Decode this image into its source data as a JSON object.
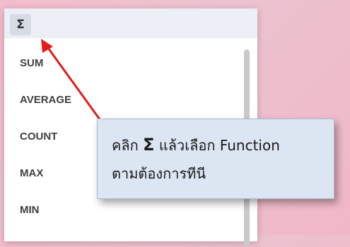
{
  "menu": {
    "sigma_button_label": "Σ",
    "items": [
      {
        "label": "SUM"
      },
      {
        "label": "AVERAGE"
      },
      {
        "label": "COUNT"
      },
      {
        "label": "MAX"
      },
      {
        "label": "MIN"
      }
    ]
  },
  "tooltip": {
    "line1_prefix": "คลิก",
    "line1_sigma": "Σ",
    "line1_suffix": "แล้วเลือก Function",
    "line2": "ตามต้องการทีนี"
  },
  "colors": {
    "arrow": "#e31b1b",
    "tooltip_bg": "#dce6f3",
    "header_bg": "#eceff6"
  },
  "icons": {
    "arrow": "red-arrow-icon",
    "sigma": "sigma-icon"
  }
}
